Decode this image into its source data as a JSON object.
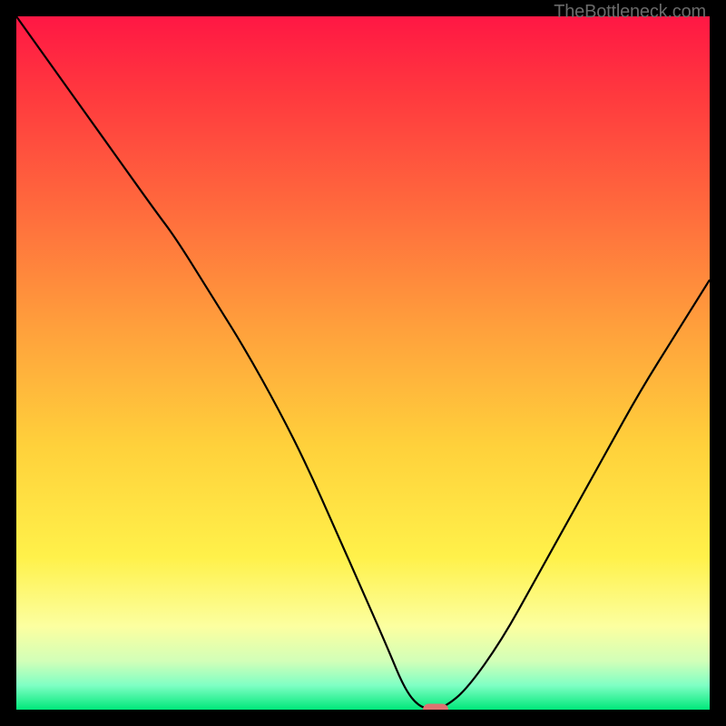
{
  "watermark": "TheBottleneck.com",
  "chart_data": {
    "type": "line",
    "title": "",
    "xlabel": "",
    "ylabel": "",
    "xlim": [
      0,
      100
    ],
    "ylim": [
      0,
      100
    ],
    "series": [
      {
        "name": "bottleneck-curve",
        "x": [
          0,
          5,
          10,
          15,
          20,
          23,
          28,
          33,
          38,
          42,
          46,
          50,
          53.5,
          56,
          58,
          60,
          62,
          65,
          70,
          75,
          80,
          85,
          90,
          95,
          100
        ],
        "y": [
          100,
          93,
          86,
          79,
          72,
          68,
          60,
          52,
          43,
          35,
          26,
          17,
          9,
          3,
          0.5,
          0,
          0.5,
          3,
          10,
          19,
          28,
          37,
          46,
          54,
          62
        ]
      }
    ],
    "marker": {
      "x": 60.5,
      "y": 0
    },
    "gradient_stops": [
      {
        "offset": 0.0,
        "color": "#ff1744"
      },
      {
        "offset": 0.12,
        "color": "#ff3b3e"
      },
      {
        "offset": 0.28,
        "color": "#ff6b3d"
      },
      {
        "offset": 0.45,
        "color": "#ffa03c"
      },
      {
        "offset": 0.62,
        "color": "#ffd13b"
      },
      {
        "offset": 0.78,
        "color": "#fff14a"
      },
      {
        "offset": 0.88,
        "color": "#fcffa0"
      },
      {
        "offset": 0.93,
        "color": "#d2ffb8"
      },
      {
        "offset": 0.965,
        "color": "#7fffc4"
      },
      {
        "offset": 1.0,
        "color": "#00e87a"
      }
    ]
  }
}
